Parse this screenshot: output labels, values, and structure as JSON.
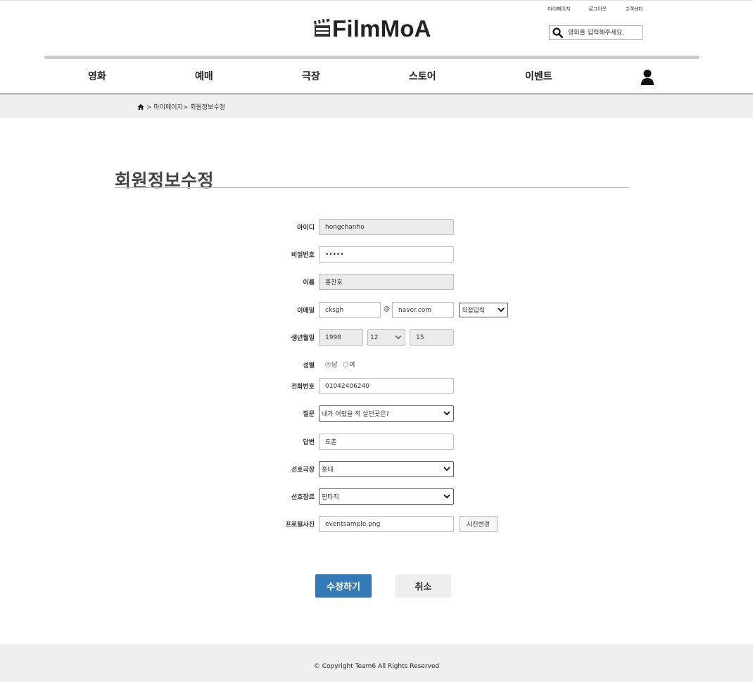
{
  "header": {
    "util_links": [
      "마이페이지",
      "로그아웃",
      "고객센터"
    ],
    "logo_text": "FilmMoA",
    "search": {
      "placeholder": "영화를 입력해주세요."
    }
  },
  "nav": {
    "items": [
      "영화",
      "예매",
      "극장",
      "스토어",
      "이벤트"
    ]
  },
  "breadcrumb": {
    "text": "> 마이페이지> 회원정보수정"
  },
  "page": {
    "title": "회원정보수정"
  },
  "form": {
    "id": {
      "label": "아이디",
      "value": "hongchanho"
    },
    "password": {
      "label": "비밀번호",
      "value": "•••••"
    },
    "name": {
      "label": "이름",
      "value": "홍찬호"
    },
    "email": {
      "label": "이메일",
      "local": "cksgh",
      "at": "@",
      "domain": "naver.com",
      "domain_select": "직접입력"
    },
    "birth": {
      "label": "생년월일",
      "year": "1998",
      "month": "12",
      "day": "15"
    },
    "gender": {
      "label": "성별",
      "options": [
        "남",
        "여"
      ],
      "selected": "남"
    },
    "phone": {
      "label": "전화번호",
      "value": "01042406240"
    },
    "question": {
      "label": "질문",
      "value": "내가 어렸을 적 살던곳은?"
    },
    "answer": {
      "label": "답변",
      "value": "도촌"
    },
    "theater": {
      "label": "선호극장",
      "value": "홍대"
    },
    "genre": {
      "label": "선호장르",
      "value": "판타지"
    },
    "photo": {
      "label": "프로필사진",
      "value": "eventsample.png",
      "change_button": "사진변경"
    }
  },
  "actions": {
    "submit": "수정하기",
    "cancel": "취소"
  },
  "footer": {
    "copyright": "© Copyright Team6 All Rights Reserved"
  },
  "colors": {
    "primary_button": "#337ab7",
    "breadcrumb_bg": "#efefef",
    "disabled_field": "#ebebeb"
  }
}
